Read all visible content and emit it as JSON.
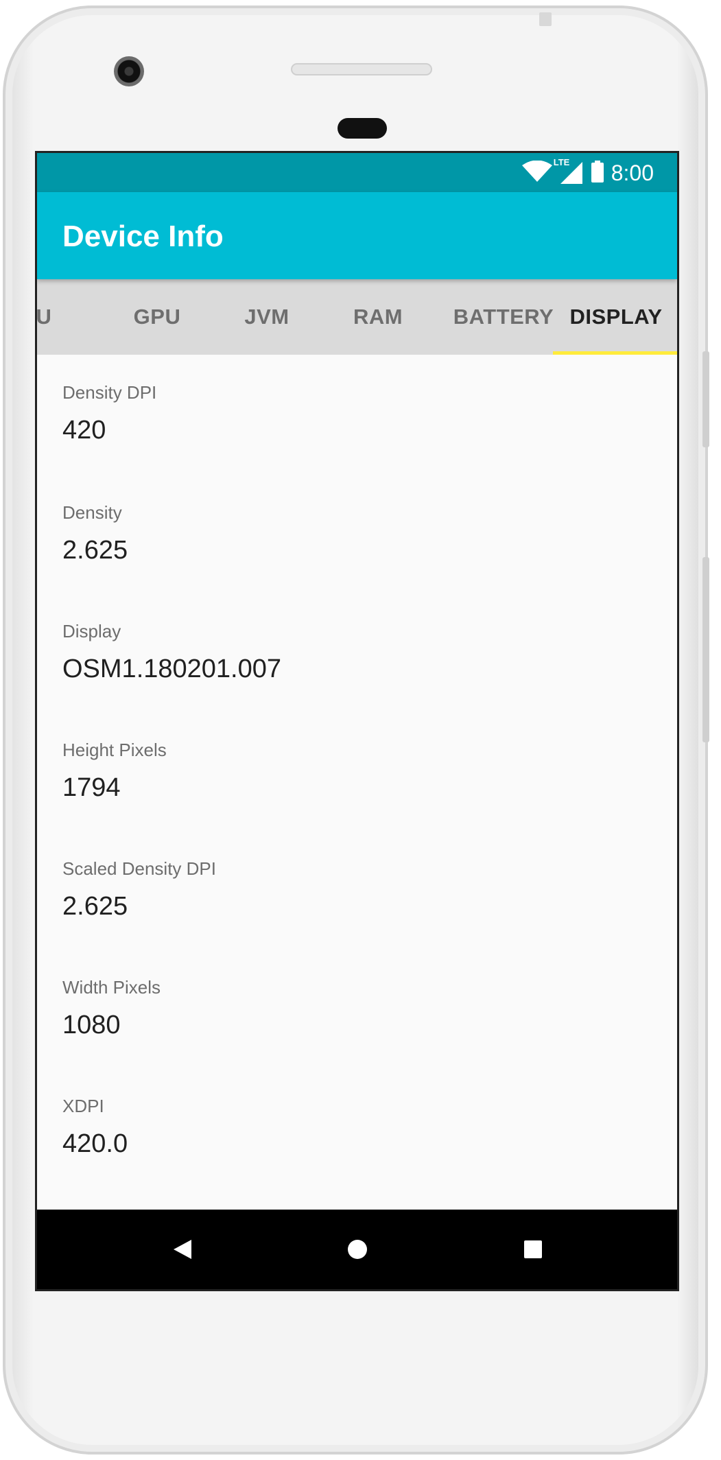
{
  "status_bar": {
    "time": "8:00",
    "network_label": "LTE",
    "icons": [
      "wifi-icon",
      "lte-signal-icon",
      "battery-icon"
    ]
  },
  "app_bar": {
    "title": "Device Info",
    "color": "#00bcd4",
    "status_color": "#0097a7"
  },
  "tabs": {
    "items": [
      {
        "label": "U"
      },
      {
        "label": "GPU"
      },
      {
        "label": "JVM"
      },
      {
        "label": "RAM"
      },
      {
        "label": "BATTERY"
      },
      {
        "label": "DISPLAY"
      }
    ],
    "active": "DISPLAY",
    "indicator_color": "#ffeb3b"
  },
  "display_info": [
    {
      "label": "Density DPI",
      "value": "420"
    },
    {
      "label": "Density",
      "value": "2.625"
    },
    {
      "label": "Display",
      "value": "OSM1.180201.007"
    },
    {
      "label": "Height Pixels",
      "value": "1794"
    },
    {
      "label": "Scaled Density DPI",
      "value": "2.625"
    },
    {
      "label": "Width Pixels",
      "value": "1080"
    },
    {
      "label": "XDPI",
      "value": "420.0"
    }
  ],
  "nav_bar": {
    "buttons": [
      "back-icon",
      "home-icon",
      "recents-icon"
    ]
  }
}
